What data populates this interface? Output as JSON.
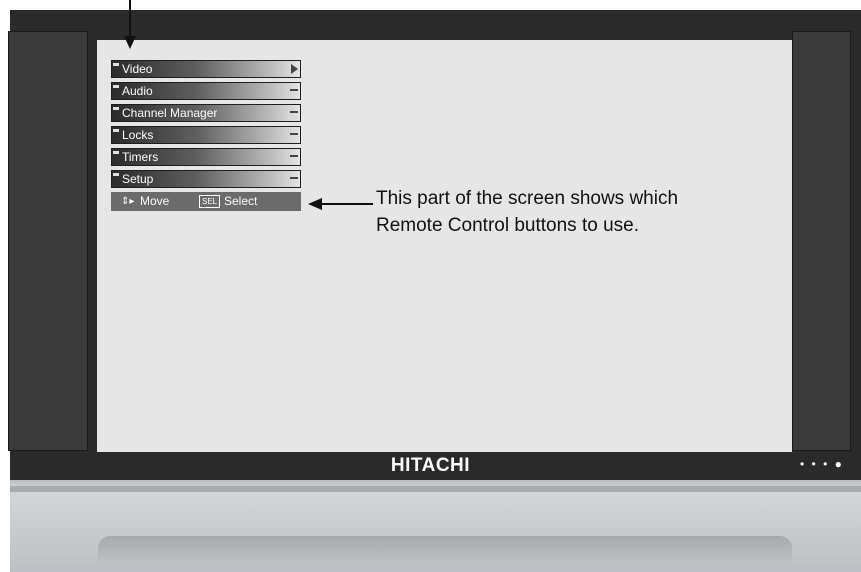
{
  "tv": {
    "brand": "HITACHI",
    "power_indicator": "• • • ●"
  },
  "menu": {
    "items": [
      {
        "label": "Video",
        "has_submenu_arrow": true
      },
      {
        "label": "Audio",
        "has_submenu_arrow": false
      },
      {
        "label": "Channel Manager",
        "has_submenu_arrow": false
      },
      {
        "label": "Locks",
        "has_submenu_arrow": false
      },
      {
        "label": "Timers",
        "has_submenu_arrow": false
      },
      {
        "label": "Setup",
        "has_submenu_arrow": false
      }
    ]
  },
  "nav_help": {
    "move_icon": "⇕▸",
    "move_label": "Move",
    "sel_icon": "SEL",
    "select_label": "Select"
  },
  "callout": {
    "line1": "This part of the screen shows which",
    "line2": "Remote Control buttons to use."
  },
  "colors": {
    "screen": "#e6e6e6",
    "frame": "#2a2a2a",
    "menu_dark": "#2b2b2b",
    "menu_light": "#e4e4e4",
    "nav_help_bg": "#6b6b6b"
  }
}
